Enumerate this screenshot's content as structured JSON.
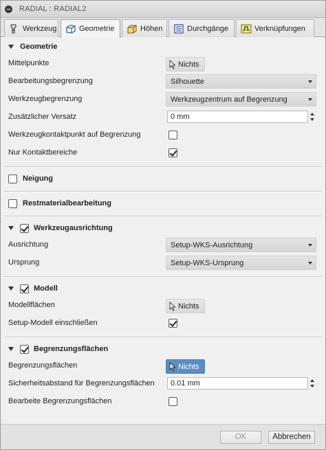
{
  "window": {
    "title": "RADIAL : RADIAL2"
  },
  "tabs": [
    {
      "label": "Werkzeug",
      "icon": "tool-icon"
    },
    {
      "label": "Geometrie",
      "icon": "geometry-cube-icon",
      "active": true
    },
    {
      "label": "Höhen",
      "icon": "heights-box-icon"
    },
    {
      "label": "Durchgänge",
      "icon": "passes-icon"
    },
    {
      "label": "Verknüpfungen",
      "icon": "linking-icon"
    }
  ],
  "geometry": {
    "header": "Geometrie",
    "mittelpunkte": {
      "label": "Mittelpunkte",
      "button": "Nichts"
    },
    "bearbeitungsbegrenzung": {
      "label": "Bearbeitungsbegrenzung",
      "value": "Silhouette"
    },
    "werkzeugbegrenzung": {
      "label": "Werkzeugbegrenzung",
      "value": "Werkzeugzentrum auf Begrenzung"
    },
    "versatz": {
      "label": "Zusätzlicher Versatz",
      "value": "0 mm"
    },
    "kontaktpunkt": {
      "label": "Werkzeugkontaktpunkt auf Begrenzung",
      "checked": false
    },
    "kontaktbereiche": {
      "label": "Nur Kontaktbereiche",
      "checked": true
    }
  },
  "neigung": {
    "header": "Neigung",
    "checked": false
  },
  "restmaterial": {
    "header": "Restmaterialbearbeitung",
    "checked": false
  },
  "ausrichtung": {
    "header": "Werkzeugausrichtung",
    "checked": true,
    "ausrichtung": {
      "label": "Ausrichtung",
      "value": "Setup-WKS-Ausrichtung"
    },
    "ursprung": {
      "label": "Ursprung",
      "value": "Setup-WKS-Ursprung"
    }
  },
  "modell": {
    "header": "Modell",
    "checked": true,
    "flaechen": {
      "label": "Modellflächen",
      "button": "Nichts"
    },
    "setup": {
      "label": "Setup-Modell einschließen",
      "checked": true
    }
  },
  "begrenzung": {
    "header": "Begrenzungsflächen",
    "checked": true,
    "flaechen": {
      "label": "Begrenzungsflächen",
      "button": "Nichts"
    },
    "abstand": {
      "label": "Sicherheitsabstand für Begrenzungsflächen",
      "value": "0.01 mm"
    },
    "bearbeite": {
      "label": "Bearbeite Begrenzungsflächen",
      "checked": false
    }
  },
  "footer": {
    "ok": "OK",
    "cancel": "Abbrechen"
  },
  "colors": {
    "accent_blue": "#5a8ec2",
    "title_bg": "#dcdcdc"
  }
}
